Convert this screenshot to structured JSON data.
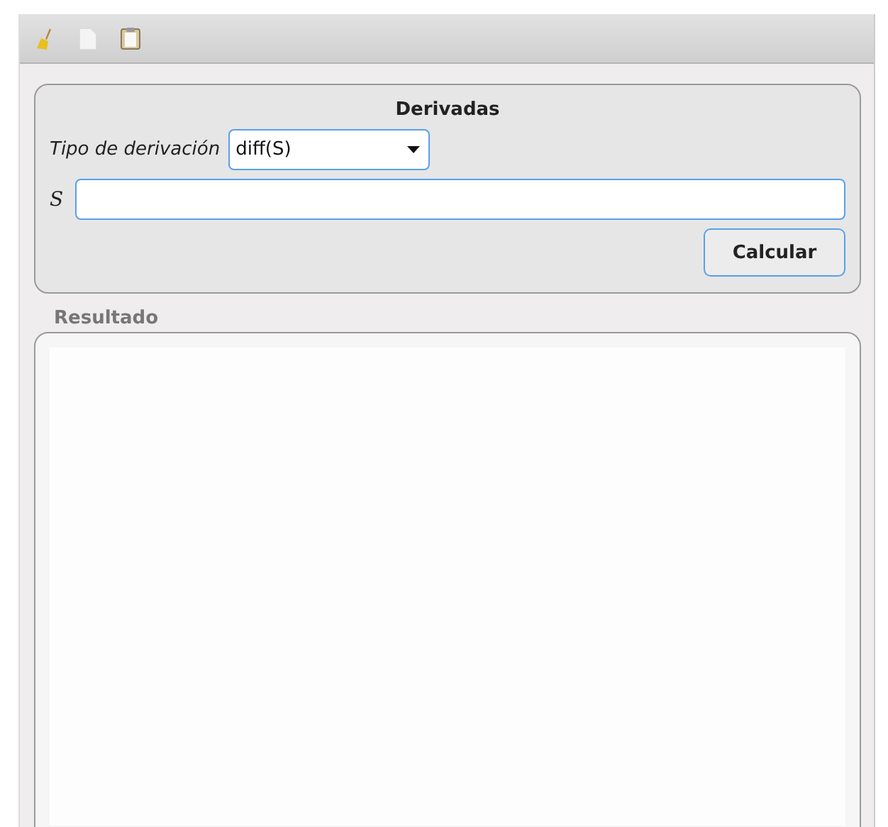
{
  "toolbar": {
    "tools": [
      {
        "kind": "broom"
      },
      {
        "kind": "page"
      },
      {
        "kind": "clipboard"
      }
    ]
  },
  "derivadas": {
    "title": "Derivadas",
    "type_label": "Tipo de derivación",
    "type_value": "diff(S)",
    "s_label": "S",
    "button": "Calcular"
  },
  "resultado": {
    "label": "Resultado"
  }
}
